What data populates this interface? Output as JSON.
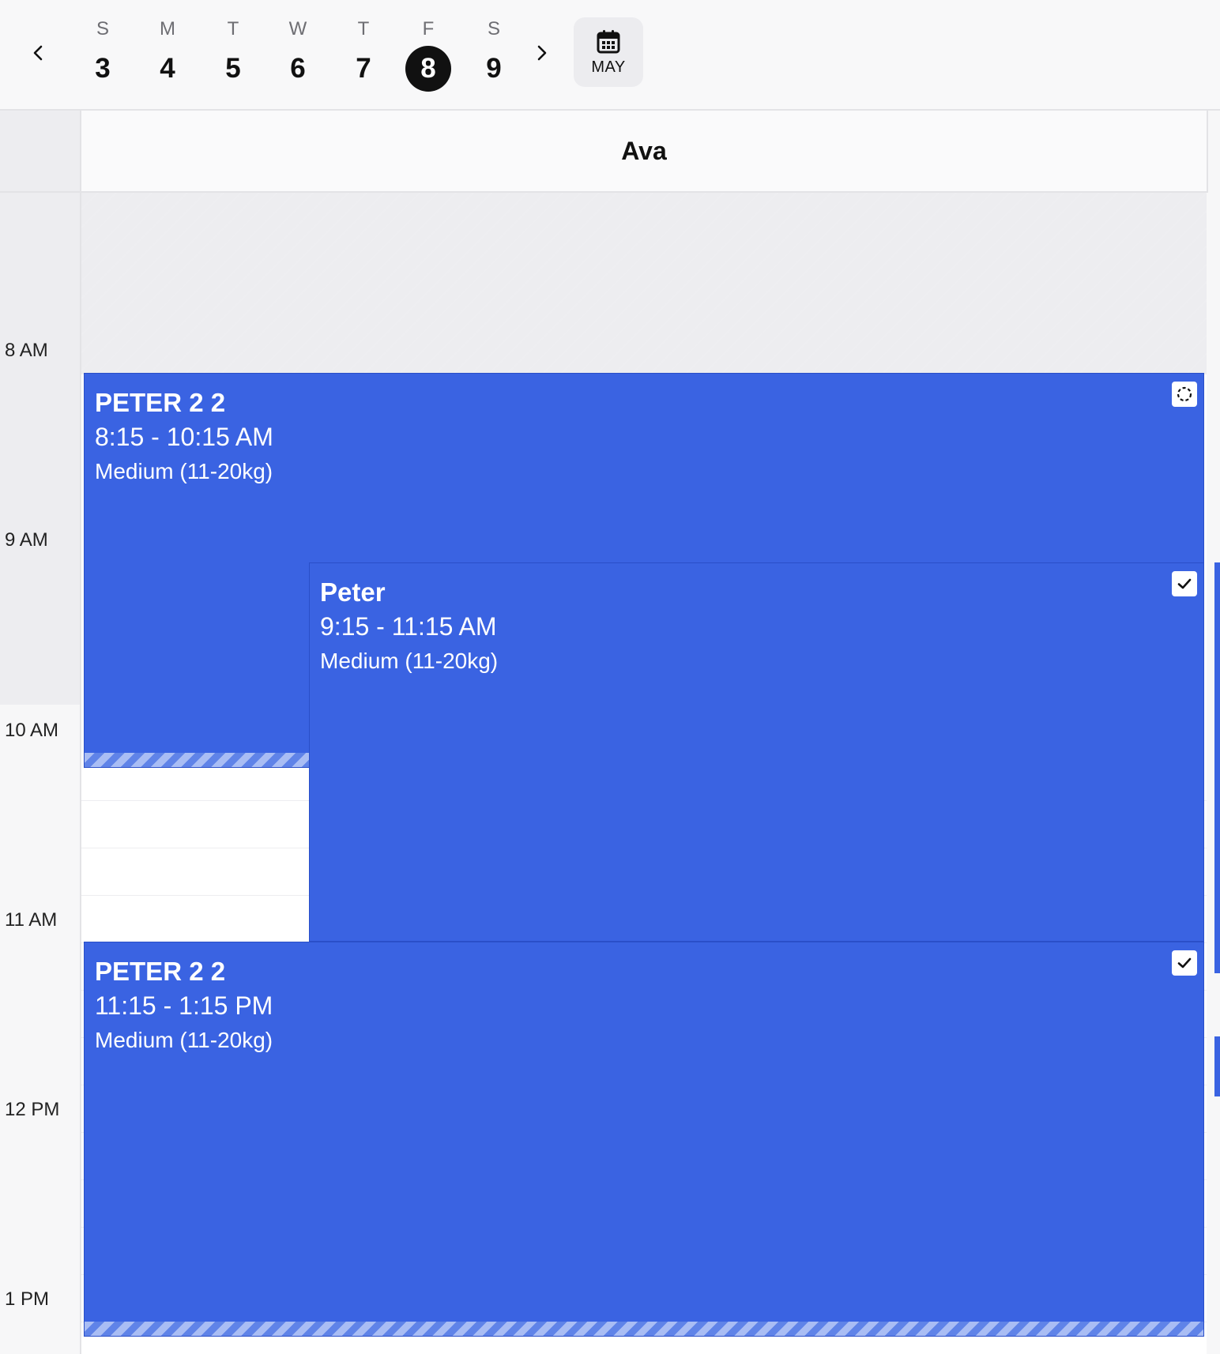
{
  "header": {
    "days": [
      {
        "dow": "S",
        "num": "3"
      },
      {
        "dow": "M",
        "num": "4"
      },
      {
        "dow": "T",
        "num": "5"
      },
      {
        "dow": "W",
        "num": "6"
      },
      {
        "dow": "T",
        "num": "7"
      },
      {
        "dow": "F",
        "num": "8",
        "selected": true
      },
      {
        "dow": "S",
        "num": "9"
      }
    ],
    "month_label": "MAY",
    "icons": {
      "prev": "chevron-left-icon",
      "next": "chevron-right-icon",
      "calendar": "calendar-icon"
    }
  },
  "staff": {
    "name": "Ava"
  },
  "time_labels": [
    "8 AM",
    "9 AM",
    "10 AM",
    "11 AM",
    "12 PM",
    "1 PM"
  ],
  "appointments": [
    {
      "title": "PETER 2 2",
      "time": "8:15 - 10:15 AM",
      "size": "Medium (11-20kg)",
      "status_icon": "pending-dashed-circle-icon"
    },
    {
      "title": "Peter",
      "time": "9:15 - 11:15 AM",
      "size": "Medium (11-20kg)",
      "status_icon": "checkmark-icon"
    },
    {
      "title": "PETER 2 2",
      "time": "11:15 - 1:15 PM",
      "size": "Medium (11-20kg)",
      "status_icon": "checkmark-icon"
    }
  ],
  "colors": {
    "appointment": "#3a63e2",
    "selected_day": "#111111",
    "closed_hours": "#ededf0"
  }
}
